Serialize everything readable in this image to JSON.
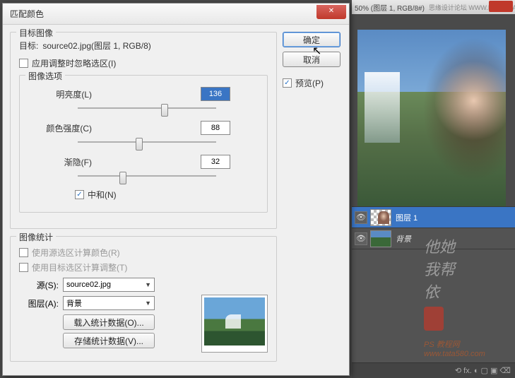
{
  "dialog": {
    "title": "匹配颜色",
    "target_group": "目标图像",
    "target_label": "目标:",
    "target_value": "source02.jpg(图层 1, RGB/8)",
    "ignore_selection": "应用调整时忽略选区(I)",
    "options_group": "图像选项",
    "brightness_label": "明亮度(L)",
    "brightness_value": "136",
    "intensity_label": "颜色强度(C)",
    "intensity_value": "88",
    "fade_label": "渐隐(F)",
    "fade_value": "32",
    "neutralize": "中和(N)",
    "stats_group": "图像统计",
    "use_src_sel": "使用源选区计算颜色(R)",
    "use_tgt_sel": "使用目标选区计算调整(T)",
    "source_label": "源(S):",
    "source_value": "source02.jpg",
    "layer_label": "图层(A):",
    "layer_value": "背景",
    "load_stats": "载入统计数据(O)...",
    "save_stats": "存储统计数据(V)..."
  },
  "buttons": {
    "ok": "确定",
    "cancel": "取消",
    "preview": "预览(P)"
  },
  "doc": {
    "title": "50% (图层 1, RGB/8#)",
    "watermark_top": "思缘设计论坛  WWW.MISSYUAN.COM"
  },
  "layers": {
    "layer1": "图层 1",
    "background": "背景"
  },
  "watermark": {
    "line1": "他她",
    "line2": "我帮",
    "line3": "依",
    "url1": "PS 教程网",
    "url2": "www.tata580.com"
  },
  "footer_icons": "⟲  fx.  ◐  ▢  ▣  ⌫"
}
